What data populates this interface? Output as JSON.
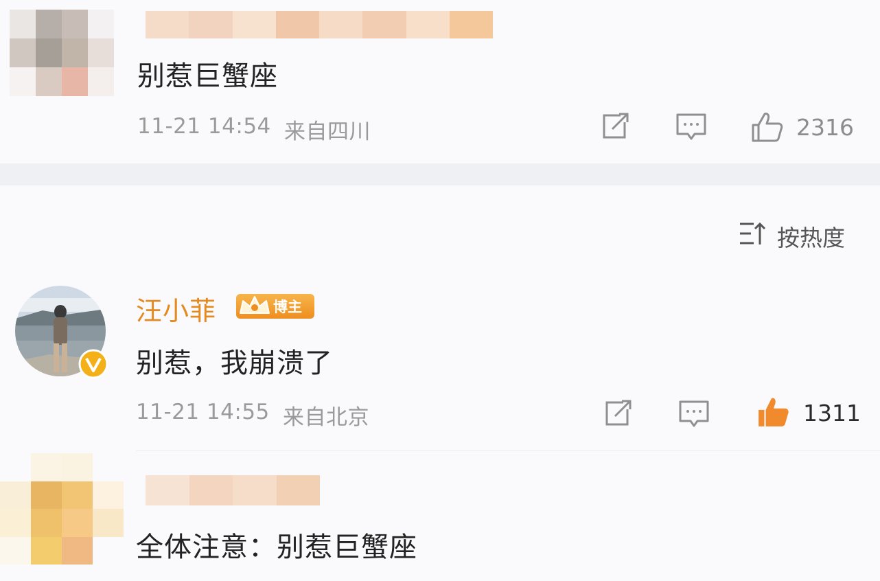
{
  "comments": [
    {
      "text": "别惹巨蟹座",
      "time": "11-21 14:54",
      "location": "来自四川",
      "likes": "2316",
      "liked": false
    },
    {
      "username": "汪小菲",
      "badge": "博主",
      "text": "别惹，我崩溃了",
      "time": "11-21 14:55",
      "location": "来自北京",
      "likes": "1311",
      "liked": true
    },
    {
      "text": "全体注意：别惹巨蟹座"
    }
  ],
  "sort": {
    "label": "按热度"
  },
  "icons": {
    "share": "share-icon",
    "comment": "comment-icon",
    "like": "thumbs-up-icon",
    "sort": "sort-icon",
    "verified": "verified-badge-icon"
  },
  "colors": {
    "liked": "#f08a2c",
    "username": "#e48a22",
    "meta": "#9a9a9a"
  }
}
